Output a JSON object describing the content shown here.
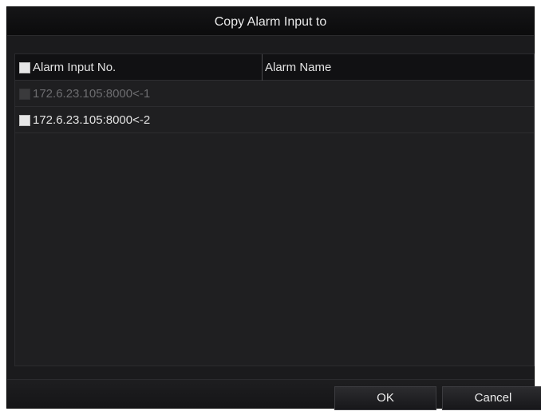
{
  "dialog": {
    "title": "Copy Alarm Input to"
  },
  "table": {
    "columns": [
      "Alarm Input No.",
      "Alarm Name"
    ],
    "rows": [
      {
        "input_no": "172.6.23.105:8000<-1",
        "alarm_name": "",
        "enabled": false,
        "checked": false
      },
      {
        "input_no": "172.6.23.105:8000<-2",
        "alarm_name": "",
        "enabled": true,
        "checked": false
      }
    ]
  },
  "buttons": {
    "ok_label": "OK",
    "cancel_label": "Cancel"
  }
}
